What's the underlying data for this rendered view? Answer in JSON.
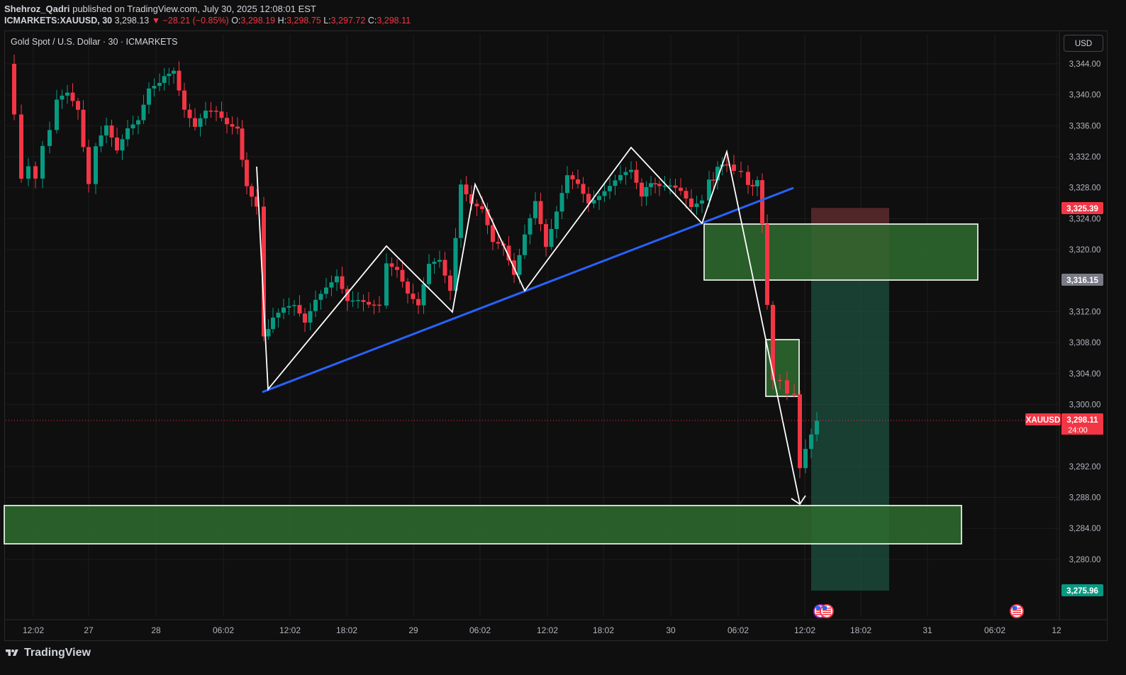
{
  "header": {
    "author": "Shehroz_Qadri",
    "published_text": "published on TradingView.com, July 30, 2025 12:08:01 EST",
    "symbol": "ICMARKETS:XAUUSD, 30",
    "last": "3,298.13",
    "change": "▼ −28.21 (−0.85%)",
    "o_label": "O:",
    "o_value": "3,298.19",
    "h_label": "H:",
    "h_value": "3,298.75",
    "l_label": "L:",
    "l_value": "3,297.72",
    "c_label": "C:",
    "c_value": "3,298.11"
  },
  "legend_title": "Gold Spot / U.S. Dollar · 30 · ICMARKETS",
  "currency_button": "USD",
  "price_axis_labels": [
    "3,344.00",
    "3,340.00",
    "3,336.00",
    "3,332.00",
    "3,328.00",
    "3,324.00",
    "3,320.00",
    "3,312.00",
    "3,308.00",
    "3,304.00",
    "3,300.00",
    "3,292.00",
    "3,288.00",
    "3,284.00",
    "3,280.00"
  ],
  "price_tags": {
    "stop": "3,325.39",
    "entry": "3,316.15",
    "symbol": "XAUUSD",
    "last": "3,298.11",
    "countdown": "24:00",
    "target": "3,275.96"
  },
  "time_axis_labels": [
    "12:02",
    "27",
    "28",
    "06:02",
    "12:02",
    "18:02",
    "29",
    "06:02",
    "12:02",
    "18:02",
    "30",
    "06:02",
    "12:02",
    "18:02",
    "31",
    "06:02",
    "12"
  ],
  "brand": "TradingView",
  "colors": {
    "bull": "#089981",
    "bear": "#f23645",
    "trendline": "#2962ff",
    "zone_fill": "#2e6b2e",
    "target_zone": "#1f5e4a",
    "stop_zone": "#5c2a2e"
  },
  "icons": [
    "flag-us-icon",
    "flag-us-icon",
    "flag-us-icon",
    "tradingview-logo-icon"
  ]
}
